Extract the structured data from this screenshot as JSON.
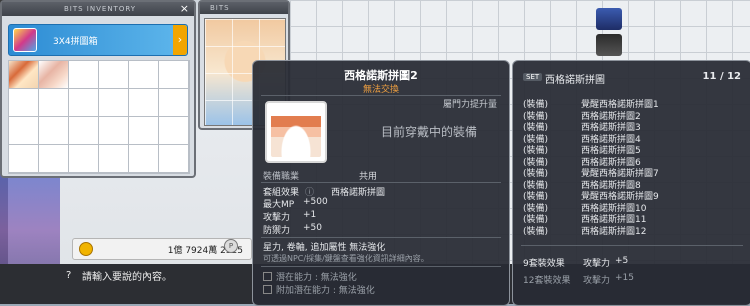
{
  "inventory": {
    "title": "BITS INVENTORY",
    "selected_item": "3X4拼圖箱",
    "close_label": "×"
  },
  "bits_panel": {
    "title": "BITS"
  },
  "meso": {
    "amount": "1億 7924萬 2525",
    "p_label": "P"
  },
  "chat": {
    "prompt": "?",
    "placeholder": "請輸入要說的內容。"
  },
  "tooltip": {
    "name": "西格諾斯拼圖2",
    "trade": "無法交換",
    "attr_upgrade": "屬門力提升量",
    "equipped_text": "目前穿戴中的裝備",
    "req_label": "裝備職業",
    "req_value": "共用",
    "set_label": "套組效果",
    "set_value": "西格諾斯拼圖",
    "stats": [
      {
        "label": "最大MP",
        "value": "+500"
      },
      {
        "label": "攻擊力",
        "value": "+1"
      },
      {
        "label": "防禦力",
        "value": "+50"
      }
    ],
    "flags": "星力, 卷軸, 追加屬性 無法強化",
    "note": "可透過NPC/採集/鍵盤查看強化資訊詳細內容。",
    "potential": "潛在能力 : 無法強化",
    "bonus_potential": "附加潛在能力 : 無法強化"
  },
  "set_panel": {
    "badge": "SET",
    "name": "西格諾斯拼圖",
    "count": "11 / 12",
    "items": [
      {
        "kind": "(裝備)",
        "name": "覺醒西格諾斯拼圖1"
      },
      {
        "kind": "(裝備)",
        "name": "西格諾斯拼圖2"
      },
      {
        "kind": "(裝備)",
        "name": "西格諾斯拼圖3"
      },
      {
        "kind": "(裝備)",
        "name": "西格諾斯拼圖4"
      },
      {
        "kind": "(裝備)",
        "name": "西格諾斯拼圖5"
      },
      {
        "kind": "(裝備)",
        "name": "西格諾斯拼圖6"
      },
      {
        "kind": "(裝備)",
        "name": "覺醒西格諾斯拼圖7"
      },
      {
        "kind": "(裝備)",
        "name": "西格諾斯拼圖8"
      },
      {
        "kind": "(裝備)",
        "name": "覺醒西格諾斯拼圖9"
      },
      {
        "kind": "(裝備)",
        "name": "西格諾斯拼圖10"
      },
      {
        "kind": "(裝備)",
        "name": "西格諾斯拼圖11"
      },
      {
        "kind": "(裝備)",
        "name": "西格諾斯拼圖12"
      }
    ],
    "bonuses": [
      {
        "label": "9套裝效果",
        "stat": "攻擊力",
        "value": "+5"
      },
      {
        "label": "12套裝效果",
        "stat": "攻擊力",
        "value": "+15"
      }
    ]
  },
  "colors": {
    "accent_blue": "#2c8bd3",
    "trade_orange": "#f0a040",
    "panel_bg": "#282c34"
  }
}
